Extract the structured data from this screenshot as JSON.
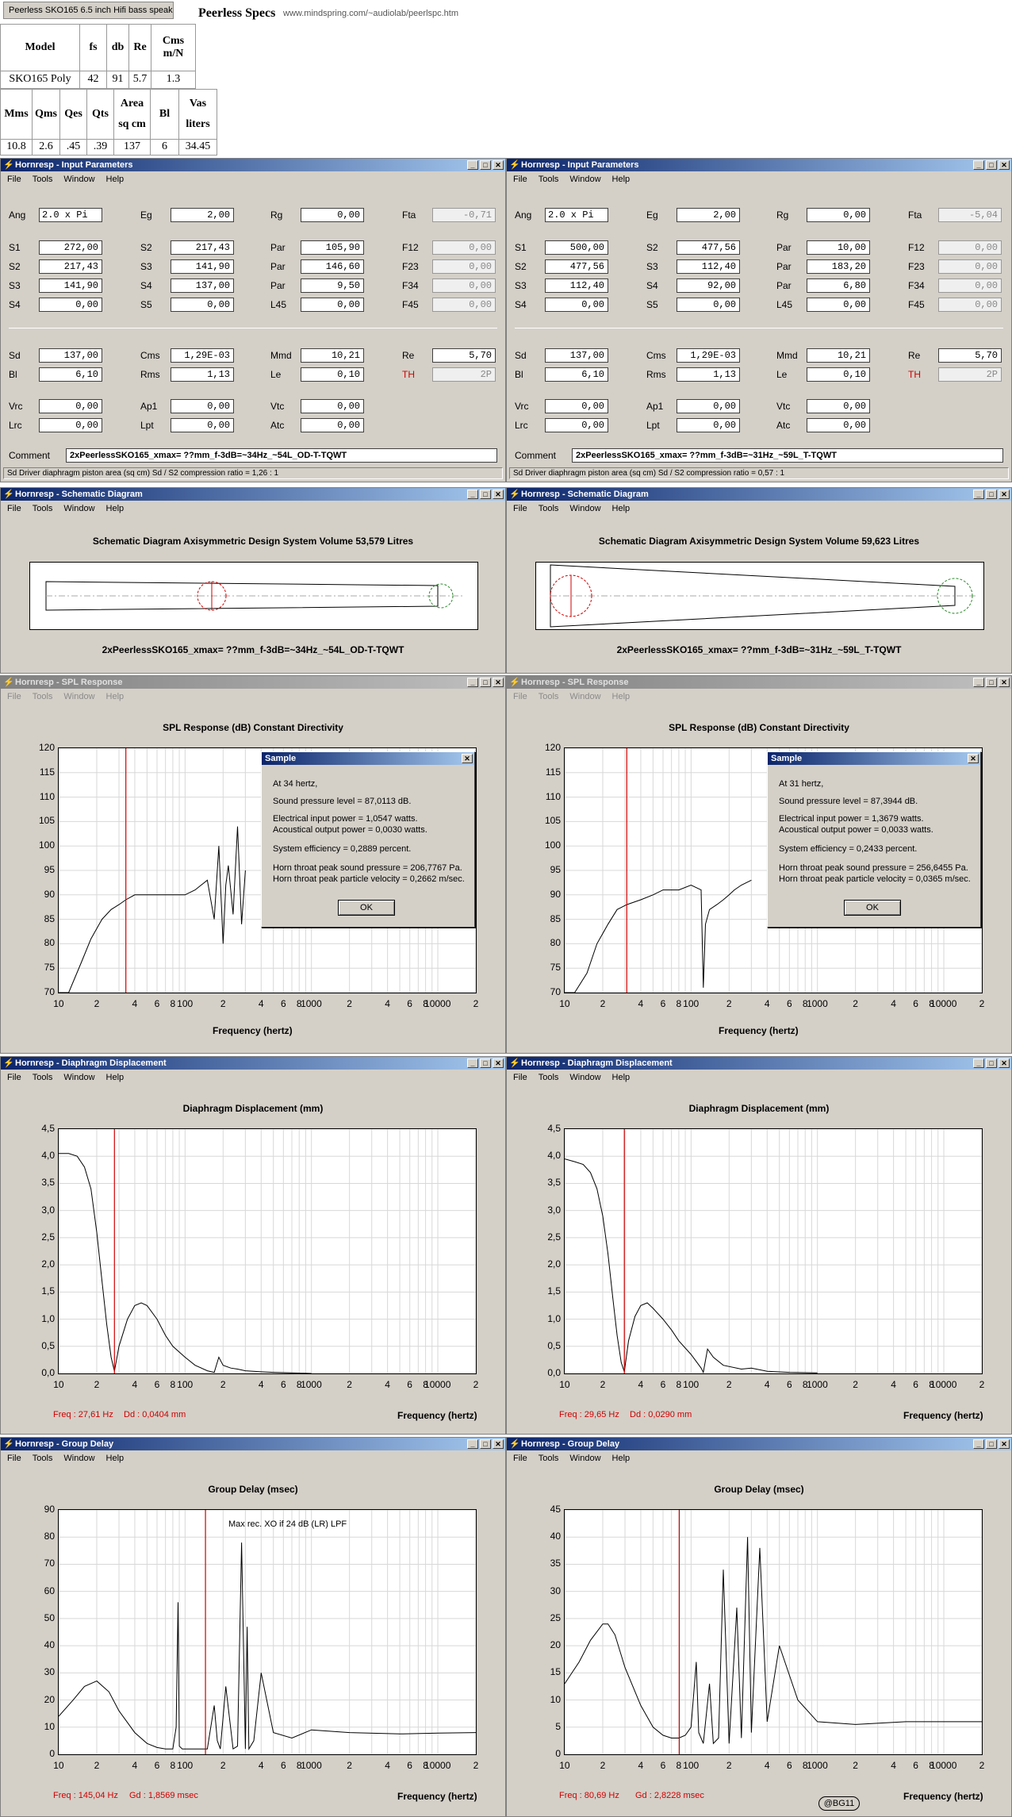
{
  "tab": {
    "label": "Peerless SKO165 6.5 inch Hifi bass speak..."
  },
  "specs": {
    "title": "Peerless Specs",
    "url": "www.mindspring.com/~audiolab/peerlspc.htm",
    "row1_headers": [
      "Model",
      "fs",
      "db",
      "Re",
      "Cms m/N"
    ],
    "row1_values": [
      "SKO165 Poly",
      "42",
      "91",
      "5.7",
      "1.3"
    ],
    "row2_headers": [
      "Mms",
      "Qms",
      "Qes",
      "Qts",
      "Area sq cm",
      "Bl",
      "Vas liters"
    ],
    "row2_values": [
      "10.8",
      "2.6",
      ".45",
      ".39",
      "137",
      "6",
      "34.45"
    ]
  },
  "menu": [
    "File",
    "Tools",
    "Window",
    "Help"
  ],
  "titles": {
    "input": "Hornresp - Input Parameters",
    "schematic": "Hornresp - Schematic Diagram",
    "spl": "Hornresp - SPL Response",
    "disp": "Hornresp - Diaphragm Displacement",
    "gd": "Hornresp - Group Delay"
  },
  "labels": {
    "comment": "Comment",
    "spl_title": "SPL Response (dB)   Constant Directivity",
    "disp_title": "Diaphragm Displacement (mm)",
    "gd_title": "Group Delay (msec)",
    "xaxis": "Frequency (hertz)",
    "dialog_title": "Sample",
    "ok": "OK",
    "gd_note": "Max rec. XO if 24 dB (LR) LPF"
  },
  "param_labels": [
    [
      "Ang",
      "Eg",
      "Rg",
      "Fta"
    ],
    [
      "S1",
      "S2",
      "Par",
      "F12"
    ],
    [
      "S2",
      "S3",
      "Par",
      "F23"
    ],
    [
      "S3",
      "S4",
      "Par",
      "F34"
    ],
    [
      "S4",
      "S5",
      "L45",
      "F45"
    ],
    [
      "Sd",
      "Cms",
      "Mmd",
      "Re"
    ],
    [
      "Bl",
      "Rms",
      "Le",
      "TH"
    ],
    [
      "Vrc",
      "Ap1",
      "Vtc",
      ""
    ],
    [
      "Lrc",
      "Lpt",
      "Atc",
      ""
    ]
  ],
  "sims": [
    {
      "params": [
        [
          "2.0 x Pi",
          "2,00",
          "0,00",
          "-0,71"
        ],
        [
          "272,00",
          "217,43",
          "105,90",
          "0,00"
        ],
        [
          "217,43",
          "141,90",
          "146,60",
          "0,00"
        ],
        [
          "141,90",
          "137,00",
          "9,50",
          "0,00"
        ],
        [
          "0,00",
          "0,00",
          "0,00",
          "0,00"
        ],
        [
          "137,00",
          "1,29E-03",
          "10,21",
          "5,70"
        ],
        [
          "6,10",
          "1,13",
          "0,10",
          "2P"
        ],
        [
          "0,00",
          "0,00",
          "0,00",
          ""
        ],
        [
          "0,00",
          "0,00",
          "0,00",
          ""
        ]
      ],
      "comment": "2xPeerlessSKO165_xmax= ??mm_f-3dB=~34Hz_~54L_OD-T-TQWT",
      "status": "Sd   Driver diaphragm piston area  (sq cm)   Sd / S2 compression ratio = 1,26 : 1",
      "schematic_title": "Schematic Diagram    Axisymmetric Design    System Volume 53,579 Litres",
      "schematic_caption": "2xPeerlessSKO165_xmax= ??mm_f-3dB=~34Hz_~54L_OD-T-TQWT",
      "dialog": {
        "l1": "At 34 hertz,",
        "l2": "Sound pressure level = 87,0113 dB.",
        "l3": "Electrical input power = 1,0547 watts.",
        "l4": "Acoustical output power = 0,0030 watts.",
        "l5": "System efficiency = 0,2889 percent.",
        "l6": "Horn throat peak sound pressure = 206,7767 Pa.",
        "l7": "Horn throat peak particle velocity = 0,2662 m/sec."
      },
      "disp_freq": "Freq : 27,61 Hz",
      "disp_dd": "Dd : 0,0404 mm",
      "gd_freq": "Freq : 145,04 Hz",
      "gd_val": "Gd : 1,8569 msec"
    },
    {
      "params": [
        [
          "2.0 x Pi",
          "2,00",
          "0,00",
          "-5,04"
        ],
        [
          "500,00",
          "477,56",
          "10,00",
          "0,00"
        ],
        [
          "477,56",
          "112,40",
          "183,20",
          "0,00"
        ],
        [
          "112,40",
          "92,00",
          "6,80",
          "0,00"
        ],
        [
          "0,00",
          "0,00",
          "0,00",
          "0,00"
        ],
        [
          "137,00",
          "1,29E-03",
          "10,21",
          "5,70"
        ],
        [
          "6,10",
          "1,13",
          "0,10",
          "2P"
        ],
        [
          "0,00",
          "0,00",
          "0,00",
          ""
        ],
        [
          "0,00",
          "0,00",
          "0,00",
          ""
        ]
      ],
      "comment": "2xPeerlessSKO165_xmax= ??mm_f-3dB=~31Hz_~59L_T-TQWT",
      "status": "Sd   Driver diaphragm piston area  (sq cm)   Sd / S2 compression ratio = 0,57 : 1",
      "schematic_title": "Schematic Diagram    Axisymmetric Design    System Volume 59,623 Litres",
      "schematic_caption": "2xPeerlessSKO165_xmax= ??mm_f-3dB=~31Hz_~59L_T-TQWT",
      "dialog": {
        "l1": "At 31 hertz,",
        "l2": "Sound pressure level = 87,3944 dB.",
        "l3": "Electrical input power = 1,3679 watts.",
        "l4": "Acoustical output power = 0,0033 watts.",
        "l5": "System efficiency = 0,2433 percent.",
        "l6": "Horn throat peak sound pressure = 256,6455 Pa.",
        "l7": "Horn throat peak particle velocity = 0,0365 m/sec."
      },
      "disp_freq": "Freq : 29,65 Hz",
      "disp_dd": "Dd : 0,0290 mm",
      "gd_freq": "Freq : 80,69 Hz",
      "gd_val": "Gd : 2,8228 msec"
    }
  ],
  "badge": "@BG11",
  "chart_data": [
    {
      "type": "line",
      "name": "SPL left",
      "title": "SPL Response (dB)   Constant Directivity",
      "xlabel": "Frequency (hertz)",
      "x_scale": "log",
      "xlim": [
        10,
        20000
      ],
      "ylim": [
        70,
        120
      ],
      "x_ticks": [
        "10",
        "2",
        "4",
        "6",
        "8",
        "100",
        "2",
        "4",
        "6",
        "8",
        "1000",
        "2",
        "4",
        "6",
        "8",
        "10000",
        "2"
      ],
      "y_ticks": [
        "120",
        "115",
        "110",
        "105",
        "100",
        "95",
        "90",
        "85",
        "80",
        "75",
        "70"
      ],
      "marker_x": 34,
      "x": [
        10,
        12,
        15,
        18,
        22,
        26,
        30,
        34,
        40,
        50,
        60,
        80,
        100,
        120,
        150,
        170,
        185,
        200,
        210,
        220,
        240,
        260,
        280,
        300
      ],
      "y": [
        66,
        70,
        76,
        81,
        85,
        87,
        88,
        89,
        90,
        90,
        90,
        90,
        90,
        91,
        93,
        85,
        100,
        80,
        92,
        96,
        86,
        104,
        84,
        95
      ]
    },
    {
      "type": "line",
      "name": "SPL right",
      "title": "SPL Response (dB)   Constant Directivity",
      "xlabel": "Frequency (hertz)",
      "x_scale": "log",
      "xlim": [
        10,
        20000
      ],
      "ylim": [
        70,
        120
      ],
      "x_ticks": [
        "10",
        "2",
        "4",
        "6",
        "8",
        "100",
        "2",
        "4",
        "6",
        "8",
        "1000",
        "2",
        "4",
        "6",
        "8",
        "10000",
        "2"
      ],
      "y_ticks": [
        "120",
        "115",
        "110",
        "105",
        "100",
        "95",
        "90",
        "85",
        "80",
        "75",
        "70"
      ],
      "marker_x": 31,
      "x": [
        10,
        12,
        15,
        18,
        22,
        26,
        31,
        40,
        50,
        60,
        80,
        100,
        120,
        125,
        130,
        140,
        160,
        180,
        200,
        220,
        250,
        300
      ],
      "y": [
        64,
        68,
        74,
        80,
        84,
        87,
        88,
        89,
        90,
        91,
        91,
        92,
        91,
        71,
        84,
        87,
        88,
        89,
        90,
        91,
        92,
        93
      ]
    },
    {
      "type": "line",
      "name": "Displacement left",
      "title": "Diaphragm Displacement (mm)",
      "xlabel": "Frequency (hertz)",
      "x_scale": "log",
      "xlim": [
        10,
        20000
      ],
      "ylim": [
        0,
        4.5
      ],
      "x_ticks": [
        "10",
        "2",
        "4",
        "6",
        "8",
        "100",
        "2",
        "4",
        "6",
        "8",
        "1000",
        "2",
        "4",
        "6",
        "8",
        "10000",
        "2"
      ],
      "y_ticks": [
        "4,5",
        "4,0",
        "3,5",
        "3,0",
        "2,5",
        "2,0",
        "1,5",
        "1,0",
        "0,5",
        "0,0"
      ],
      "marker_x": 27.61,
      "x": [
        10,
        12,
        14,
        16,
        18,
        20,
        22,
        24,
        26,
        27.6,
        30,
        35,
        40,
        45,
        50,
        60,
        70,
        80,
        100,
        120,
        150,
        170,
        185,
        200,
        230,
        260,
        300,
        400,
        500,
        700,
        1000
      ],
      "y": [
        4.05,
        4.05,
        4.0,
        3.8,
        3.4,
        2.6,
        1.7,
        0.9,
        0.3,
        0.04,
        0.5,
        1.0,
        1.25,
        1.3,
        1.25,
        1.0,
        0.7,
        0.5,
        0.3,
        0.15,
        0.05,
        0.02,
        0.3,
        0.15,
        0.1,
        0.08,
        0.05,
        0.03,
        0.02,
        0.01,
        0.0
      ]
    },
    {
      "type": "line",
      "name": "Displacement right",
      "title": "Diaphragm Displacement (mm)",
      "xlabel": "Frequency (hertz)",
      "x_scale": "log",
      "xlim": [
        10,
        20000
      ],
      "ylim": [
        0,
        4.5
      ],
      "x_ticks": [
        "10",
        "2",
        "4",
        "6",
        "8",
        "100",
        "2",
        "4",
        "6",
        "8",
        "1000",
        "2",
        "4",
        "6",
        "8",
        "10000",
        "2"
      ],
      "y_ticks": [
        "4,5",
        "4,0",
        "3,5",
        "3,0",
        "2,5",
        "2,0",
        "1,5",
        "1,0",
        "0,5",
        "0,0"
      ],
      "marker_x": 29.65,
      "x": [
        10,
        12,
        14,
        16,
        18,
        20,
        22,
        24,
        26,
        28,
        29.65,
        32,
        36,
        40,
        45,
        50,
        60,
        70,
        80,
        100,
        120,
        125,
        135,
        150,
        180,
        250,
        300,
        400,
        600,
        1000
      ],
      "y": [
        3.95,
        3.9,
        3.85,
        3.7,
        3.4,
        2.9,
        2.2,
        1.4,
        0.7,
        0.2,
        0.03,
        0.6,
        1.05,
        1.25,
        1.3,
        1.2,
        1.0,
        0.8,
        0.6,
        0.35,
        0.1,
        0.02,
        0.45,
        0.3,
        0.15,
        0.08,
        0.1,
        0.04,
        0.02,
        0.01
      ]
    },
    {
      "type": "line",
      "name": "Group delay left",
      "title": "Group Delay (msec)",
      "xlabel": "Frequency (hertz)",
      "x_scale": "log",
      "xlim": [
        10,
        20000
      ],
      "ylim": [
        0,
        90
      ],
      "x_ticks": [
        "10",
        "2",
        "4",
        "6",
        "8",
        "100",
        "2",
        "4",
        "6",
        "8",
        "1000",
        "2",
        "4",
        "6",
        "8",
        "10000",
        "2"
      ],
      "y_ticks": [
        "90",
        "80",
        "70",
        "60",
        "50",
        "40",
        "30",
        "20",
        "10",
        "0"
      ],
      "marker_x": 145.04,
      "x": [
        10,
        13,
        16,
        20,
        25,
        30,
        40,
        50,
        60,
        70,
        80,
        85,
        88,
        90,
        95,
        105,
        130,
        150,
        170,
        180,
        190,
        210,
        240,
        260,
        280,
        300,
        310,
        320,
        350,
        400,
        500,
        700,
        1000,
        2000,
        5000,
        10000,
        20000
      ],
      "y": [
        14,
        20,
        25,
        27,
        23,
        16,
        8,
        4,
        2.5,
        2,
        2,
        10,
        56,
        3,
        2,
        2,
        2,
        2,
        18,
        5,
        2,
        25,
        2,
        3,
        78,
        2,
        47,
        2,
        5,
        30,
        8,
        6,
        9,
        8,
        7.5,
        7.8,
        8
      ]
    },
    {
      "type": "line",
      "name": "Group delay right",
      "title": "Group Delay (msec)",
      "xlabel": "Frequency (hertz)",
      "x_scale": "log",
      "xlim": [
        10,
        20000
      ],
      "ylim": [
        0,
        45
      ],
      "x_ticks": [
        "10",
        "2",
        "4",
        "6",
        "8",
        "100",
        "2",
        "4",
        "6",
        "8",
        "1000",
        "2",
        "4",
        "6",
        "8",
        "10000",
        "2"
      ],
      "y_ticks": [
        "45",
        "40",
        "35",
        "30",
        "25",
        "20",
        "15",
        "10",
        "5",
        "0"
      ],
      "marker_x": 80.69,
      "x": [
        10,
        13,
        16,
        20,
        22,
        25,
        30,
        40,
        50,
        60,
        70,
        80,
        90,
        100,
        110,
        115,
        125,
        140,
        150,
        165,
        180,
        200,
        230,
        250,
        280,
        300,
        350,
        400,
        500,
        700,
        1000,
        2000,
        5000,
        10000,
        20000
      ],
      "y": [
        13,
        17,
        21,
        24,
        24,
        22,
        16,
        9,
        5,
        3.5,
        3,
        3,
        3.5,
        5,
        17,
        4,
        2,
        13,
        2,
        3,
        34,
        2,
        27,
        3,
        40,
        4,
        38,
        6,
        20,
        10,
        6,
        5.5,
        6,
        6,
        6
      ]
    }
  ]
}
